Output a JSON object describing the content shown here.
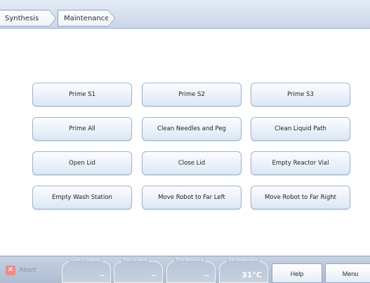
{
  "breadcrumb": [
    "Synthesis",
    "Maintenance"
  ],
  "buttons": [
    [
      "Prime S1",
      "Prime S2",
      "Prime S3"
    ],
    [
      "Prime All",
      "Clean Needles and Peg",
      "Clean Liquid Path"
    ],
    [
      "Open Lid",
      "Close Lid",
      "Empty Reactor Vial"
    ],
    [
      "Empty Wash Station",
      "Move Robot to Far Left",
      "Move Robot to Far Right"
    ]
  ],
  "bottom": {
    "abort_label": "Abort",
    "gauges": [
      {
        "label": "Cycle in Progress",
        "value": "--"
      },
      {
        "label": "Time to Pause",
        "value": "--"
      },
      {
        "label": "Time Remaining",
        "value": "--"
      },
      {
        "label": "Vial Temperature",
        "value": "31°C"
      }
    ],
    "help_label": "Help",
    "menu_label": "Menu"
  }
}
